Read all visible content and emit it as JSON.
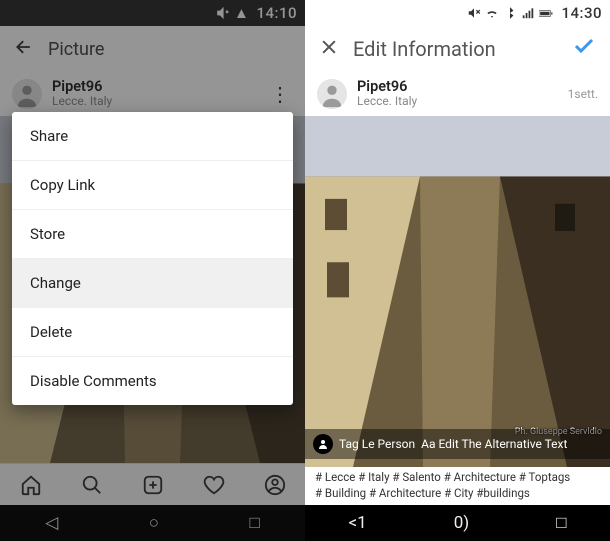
{
  "left": {
    "status": {
      "time": "14:10"
    },
    "topbar": {
      "title": "Picture"
    },
    "user": {
      "name": "Pipet96",
      "location": "Lecce. Italy"
    },
    "menu": {
      "share": "Share",
      "copy_link": "Copy Link",
      "store": "Store",
      "change": "Change",
      "delete": "Delete",
      "disable_comments": "Disable Comments"
    }
  },
  "right": {
    "status": {
      "time": "14:30"
    },
    "topbar": {
      "title": "Edit Information"
    },
    "user": {
      "name": "Pipet96",
      "location": "Lecce. Italy",
      "time": "1sett."
    },
    "tag_strip": {
      "tag_people": "Tag Le Person",
      "alt_text": "Aa Edit The Alternative Text"
    },
    "credit": "Ph. Giuseppe Servidio",
    "caption": {
      "line1": "# Lecce # Italy # Salento # Architecture # Toptags",
      "line2": "# Building # Architecture # City #buildings"
    }
  },
  "navbar": {
    "back": "◁",
    "home": "○",
    "recent": "□",
    "back2": "<1",
    "home2": "0)",
    "recent2": "□"
  }
}
